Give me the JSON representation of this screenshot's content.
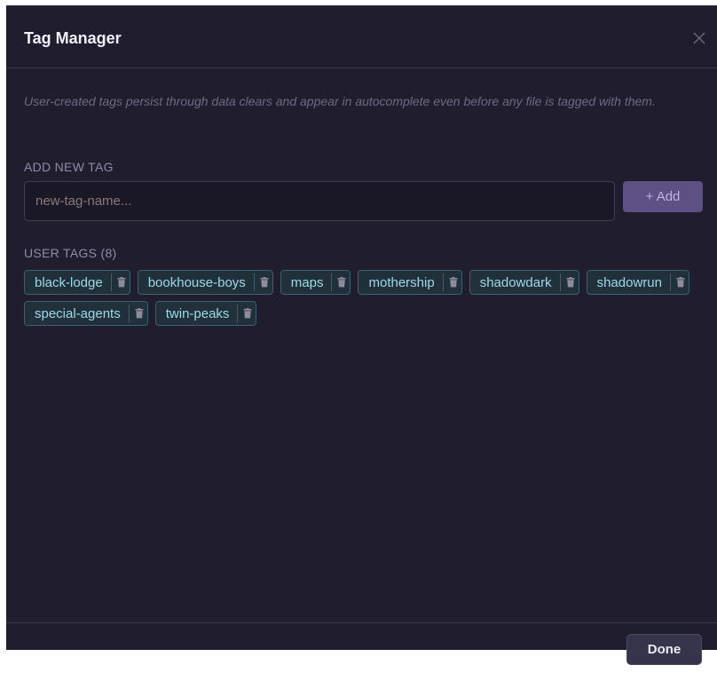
{
  "dialog": {
    "title": "Tag Manager",
    "close_icon": "close-icon"
  },
  "description": "User-created tags persist through data clears and appear in autocomplete even before any file is tagged with them.",
  "add_tag": {
    "label": "ADD NEW TAG",
    "input_value": "",
    "placeholder": "new-tag-name...",
    "button_label": "+ Add"
  },
  "user_tags": {
    "label": "USER TAGS (8)",
    "delete_icon": "trash-icon",
    "tags": [
      "black-lodge",
      "bookhouse-boys",
      "maps",
      "mothership",
      "shadowdark",
      "shadowrun",
      "special-agents",
      "twin-peaks"
    ]
  },
  "footer": {
    "done_label": "Done"
  },
  "colors": {
    "background": "#1f1d2e",
    "accent": "#5e4f85",
    "tag_text": "#9ed9e6",
    "tag_border": "#3e5f6e",
    "muted_text": "#6e6a86"
  }
}
